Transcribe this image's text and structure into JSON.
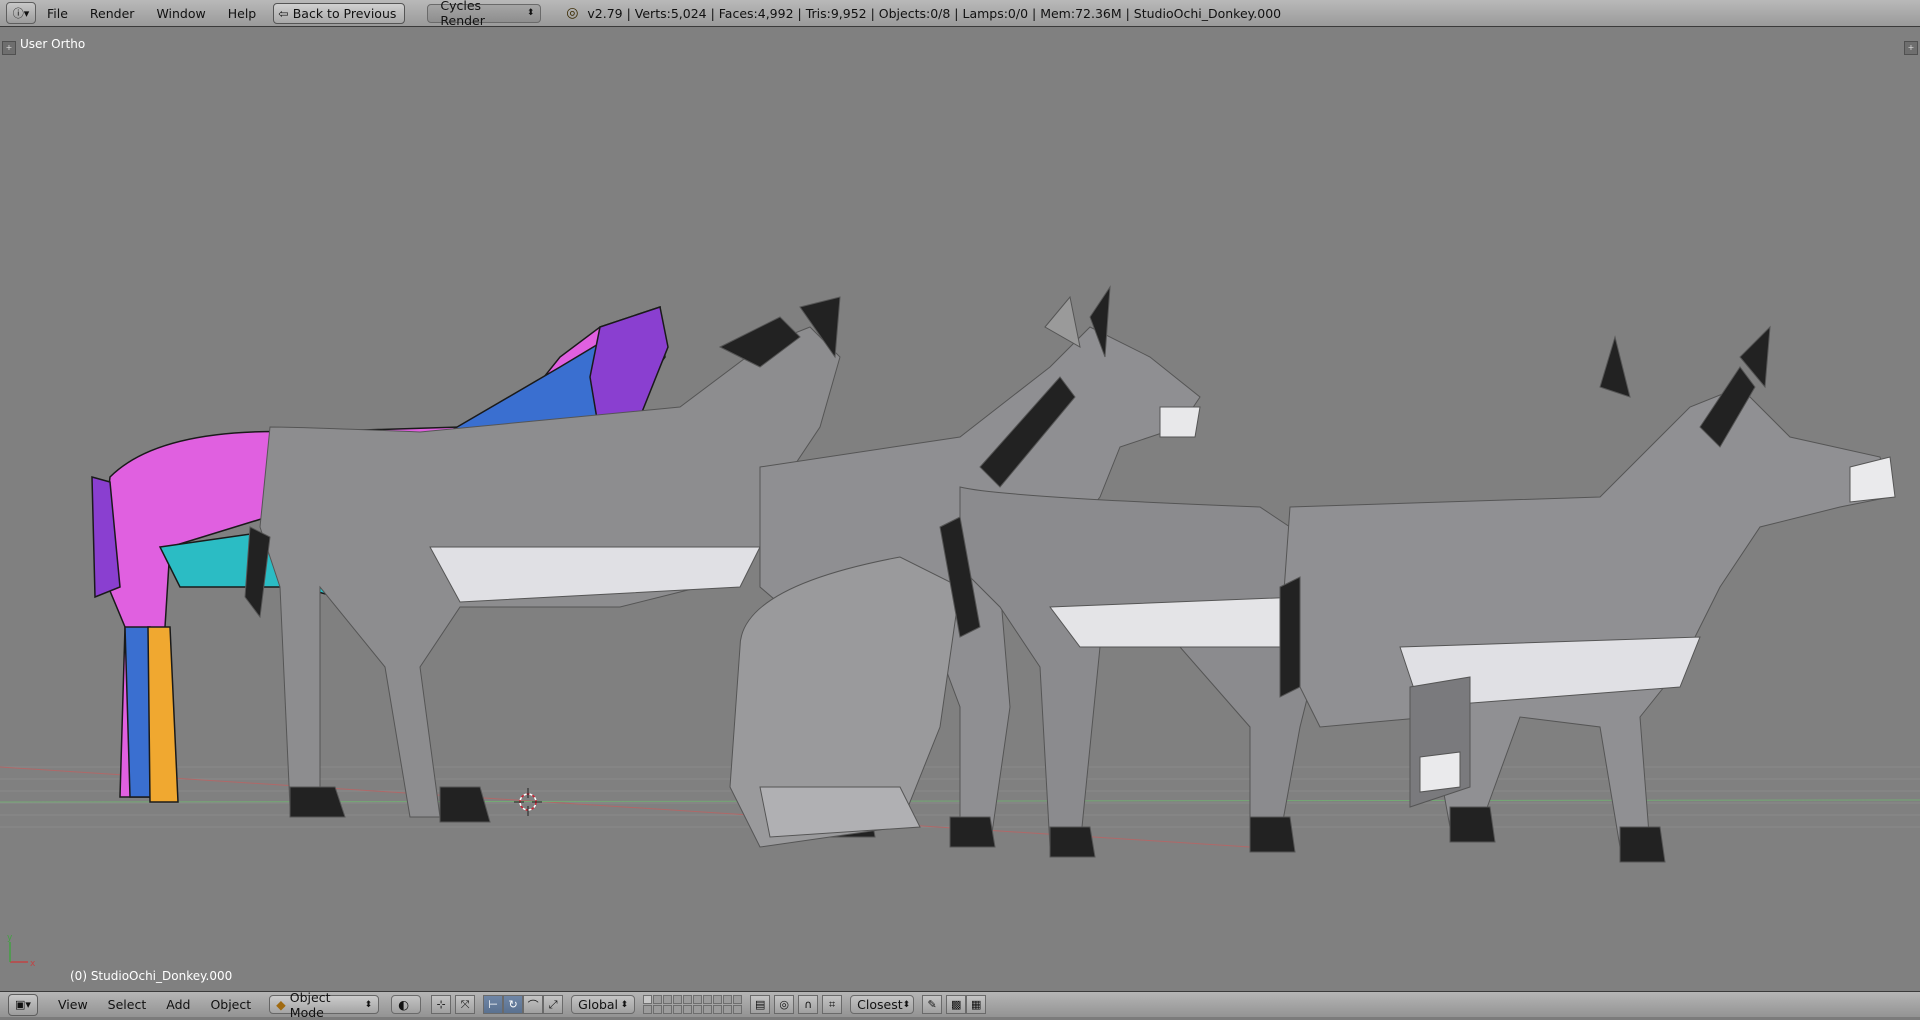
{
  "top_header": {
    "menus": [
      "File",
      "Render",
      "Window",
      "Help"
    ],
    "back_button": "Back to Previous",
    "render_engine": "Cycles Render",
    "stats": "v2.79 | Verts:5,024 | Faces:4,992 | Tris:9,952 | Objects:0/8 | Lamps:0/0 | Mem:72.36M | StudioOchi_Donkey.000"
  },
  "viewport": {
    "view_name": "User Ortho",
    "active_object_label": "(0) StudioOchi_Donkey.000",
    "axis_x": "x",
    "axis_y": "y"
  },
  "bottom_header": {
    "menus": [
      "View",
      "Select",
      "Add",
      "Object"
    ],
    "mode": "Object Mode",
    "transform_orientation": "Global",
    "snap_target": "Closest"
  },
  "colors": {
    "viewport_bg": "#808080",
    "donkey_body": "#8d8d8f",
    "donkey_belly": "#e0e0e4",
    "donkey_dark": "#222222",
    "uv_pink": "#e060e0",
    "uv_blue": "#3a6fd0",
    "uv_purple": "#8a3fd0",
    "uv_cyan": "#2bbcc4",
    "uv_orange": "#f0a830"
  }
}
